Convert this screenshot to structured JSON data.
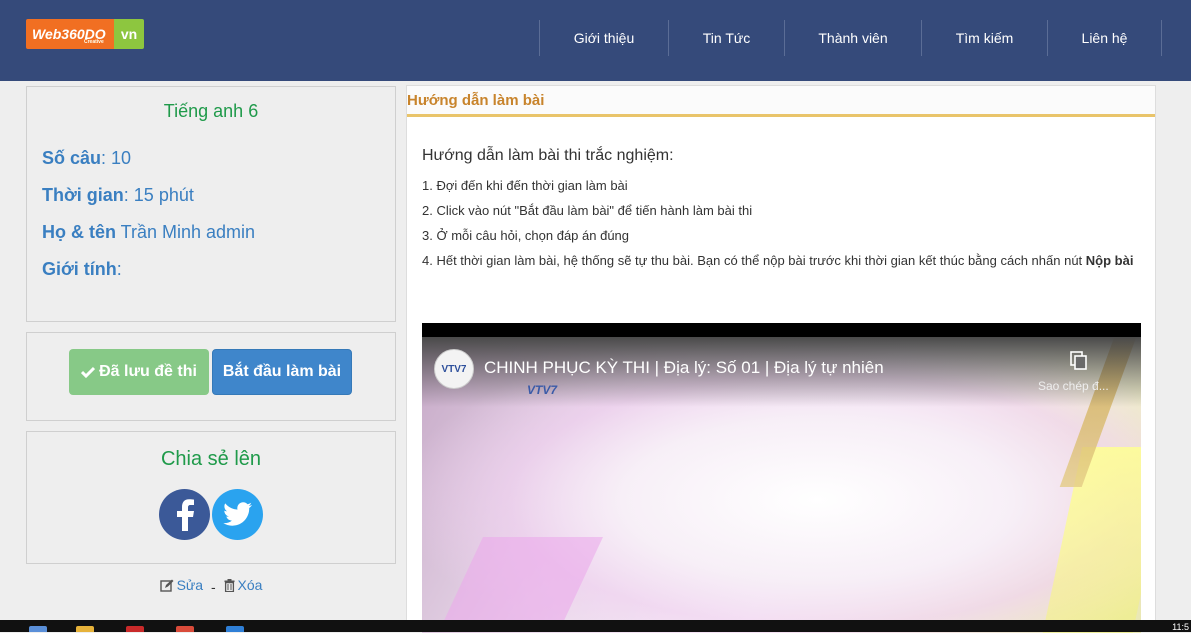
{
  "header": {
    "logo_main": "Web360DO",
    "logo_sub": "Creative",
    "logo_suffix": "vn",
    "nav": [
      {
        "label": "Giới thiệu"
      },
      {
        "label": "Tin Tức"
      },
      {
        "label": "Thành viên"
      },
      {
        "label": "Tìm kiếm"
      },
      {
        "label": "Liên hệ"
      }
    ]
  },
  "exam": {
    "title": "Tiếng anh 6",
    "questions_label": "Số câu",
    "questions_value": ": 10",
    "time_label": "Thời gian",
    "time_value": ": 15 phút",
    "name_label": "Họ & tên",
    "name_value": " Trần Minh admin",
    "gender_label": "Giới tính",
    "gender_value": ":"
  },
  "actions": {
    "saved_label": "Đã lưu đề thi",
    "start_label": "Bắt đầu làm bài"
  },
  "share": {
    "title": "Chia sẻ lên"
  },
  "edit": {
    "edit_label": "Sửa",
    "separator": "-",
    "delete_label": "Xóa"
  },
  "guide": {
    "heading": "Hướng dẫn làm bài",
    "intro": "Hướng dẫn làm bài thi trắc nghiệm:",
    "steps": [
      "1. Đợi đến khi đến thời gian làm bài",
      "2. Click vào nút \"Bắt đầu làm bài\" để tiến hành làm bài thi",
      "3. Ở mỗi câu hỏi, chọn đáp án đúng",
      "4. Hết thời gian làm bài, hệ thống sẽ tự thu bài. Bạn có thể nộp bài trước khi thời gian kết thúc bằng cách nhấn nút "
    ],
    "submit_bold": "Nộp bài"
  },
  "video": {
    "channel_badge": "VTV7",
    "title": "CHINH PHỤC KỲ THI | Địa lý: Số 01 | Địa lý tự nhiên",
    "watermark": "VTV7",
    "copy_label": "Sao chép đ..."
  },
  "taskbar": {
    "clock": "11:5"
  },
  "colors": {
    "header_bg": "#354a7a",
    "logo_orange": "#f16f22",
    "logo_green": "#8dc63f",
    "accent_green": "#1f9a4a",
    "link_blue": "#3a7fc1",
    "btn_saved": "#87c987",
    "btn_start": "#3f86cb",
    "guide_heading": "#c8842c",
    "guide_underline": "#e9c46a"
  }
}
